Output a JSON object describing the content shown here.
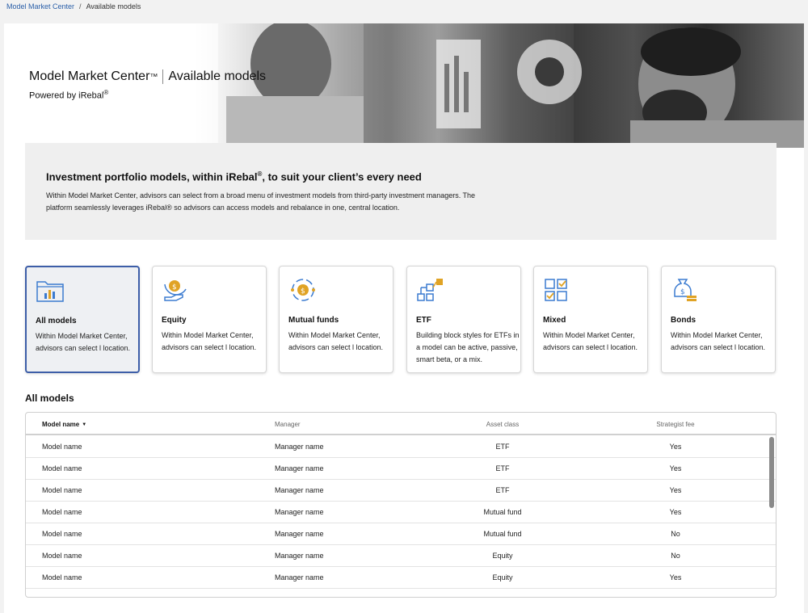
{
  "breadcrumb": {
    "home": "Model Market Center",
    "separator": "/",
    "current": "Available models"
  },
  "hero": {
    "title_main": "Model Market Center",
    "title_tm": "™",
    "title_section": "Available models",
    "powered_by": "Powered by iRebal",
    "powered_by_mark": "®"
  },
  "intro": {
    "heading_pre": "Investment portfolio models, within iRebal",
    "heading_mark": "®",
    "heading_post": ", to suit your client’s every need",
    "body": "Within Model Market Center, advisors can select from a broad menu of investment models from third-party investment managers. The platform seamlessly leverages iRebal® so advisors can access models and rebalance in one, central location."
  },
  "cards": [
    {
      "title": "All models",
      "desc": "Within Model Market Center, advisors can select l location.",
      "icon": "folder-chart-icon",
      "selected": true
    },
    {
      "title": "Equity",
      "desc": "Within Model Market Center, advisors can select l location.",
      "icon": "hand-coin-icon",
      "selected": false
    },
    {
      "title": "Mutual funds",
      "desc": "Within Model Market Center, advisors can select l location.",
      "icon": "coin-cycle-icon",
      "selected": false
    },
    {
      "title": "ETF",
      "desc": "Building block styles for ETFs in a model can be active, passive, smart beta, or a mix.",
      "icon": "blocks-flow-icon",
      "selected": false
    },
    {
      "title": "Mixed",
      "desc": "Within Model Market Center, advisors can select l location.",
      "icon": "checkbox-grid-icon",
      "selected": false
    },
    {
      "title": "Bonds",
      "desc": "Within Model Market Center, advisors can select l location.",
      "icon": "money-bag-icon",
      "selected": false
    }
  ],
  "list": {
    "title": "All models",
    "columns": {
      "name": "Model name",
      "manager": "Manager",
      "asset": "Asset class",
      "fee": "Strategist fee"
    },
    "sort_indicator": "▼",
    "rows": [
      {
        "name": "Model name",
        "manager": "Manager name",
        "asset": "ETF",
        "fee": "Yes"
      },
      {
        "name": "Model name",
        "manager": "Manager name",
        "asset": "ETF",
        "fee": "Yes"
      },
      {
        "name": "Model name",
        "manager": "Manager name",
        "asset": "ETF",
        "fee": "Yes"
      },
      {
        "name": "Model name",
        "manager": "Manager name",
        "asset": "Mutual fund",
        "fee": "Yes"
      },
      {
        "name": "Model name",
        "manager": "Manager name",
        "asset": "Mutual fund",
        "fee": "No"
      },
      {
        "name": "Model name",
        "manager": "Manager name",
        "asset": "Equity",
        "fee": "No"
      },
      {
        "name": "Model name",
        "manager": "Manager name",
        "asset": "Equity",
        "fee": "Yes"
      }
    ]
  },
  "colors": {
    "accent": "#3d5ea8",
    "icon_blue": "#3b7bd0",
    "icon_gold": "#e0a325",
    "link": "#2a5fa8"
  }
}
